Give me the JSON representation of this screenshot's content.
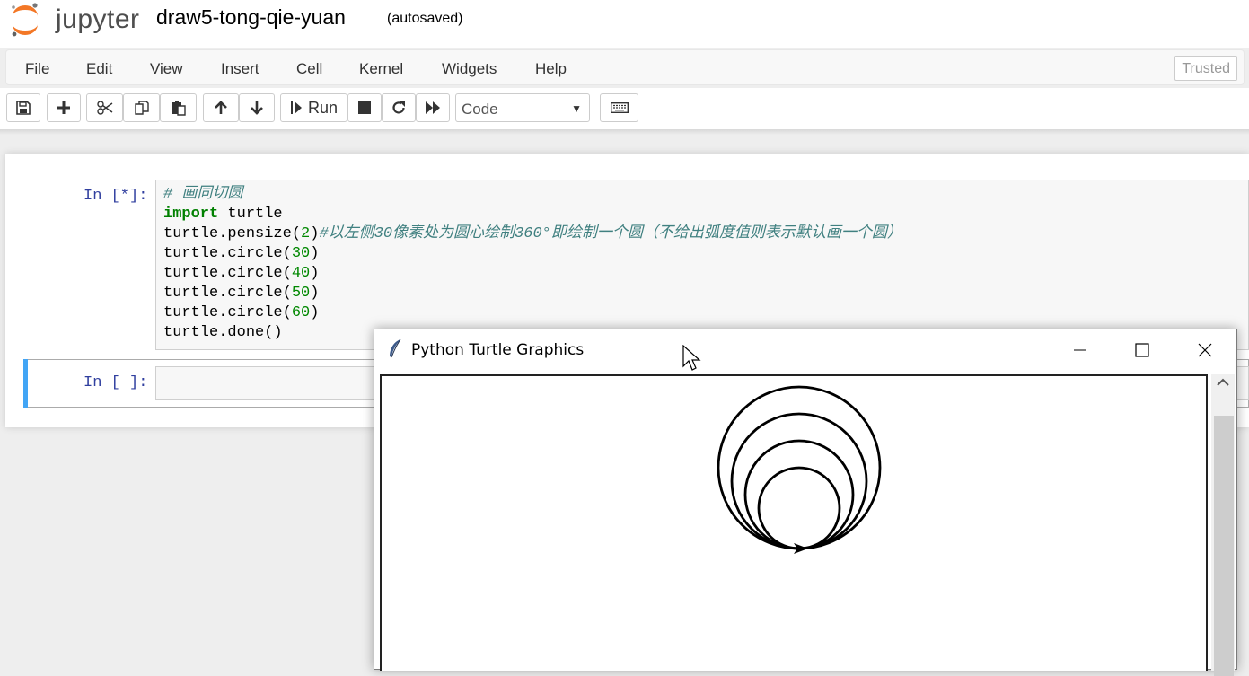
{
  "header": {
    "logo_text": "jupyter",
    "notebook_title": "draw5-tong-qie-yuan",
    "autosave_status": "(autosaved)"
  },
  "menubar": {
    "items": [
      "File",
      "Edit",
      "View",
      "Insert",
      "Cell",
      "Kernel",
      "Widgets",
      "Help"
    ],
    "trusted_label": "Trusted"
  },
  "toolbar": {
    "run_label": "Run",
    "cell_type": "Code",
    "icons": [
      "save-icon",
      "plus-icon",
      "scissors-icon",
      "copy-icon",
      "paste-icon",
      "arrow-up-icon",
      "arrow-down-icon",
      "step-run-icon",
      "stop-icon",
      "restart-icon",
      "fast-forward-icon",
      "keyboard-icon"
    ]
  },
  "cells": [
    {
      "prompt": "In [*]:",
      "code": [
        {
          "parts": [
            {
              "t": "# 画同切圆",
              "c": "cm"
            }
          ]
        },
        {
          "parts": [
            {
              "t": "import",
              "c": "kw"
            },
            {
              "t": " turtle",
              "c": ""
            }
          ]
        },
        {
          "parts": [
            {
              "t": "turtle.pensize(",
              "c": ""
            },
            {
              "t": "2",
              "c": "num"
            },
            {
              "t": ")",
              "c": ""
            },
            {
              "t": "#以左侧30像素处为圆心绘制360°即绘制一个圆（不给出弧度值则表示默认画一个圆）",
              "c": "cm"
            }
          ]
        },
        {
          "parts": [
            {
              "t": "turtle.circle(",
              "c": ""
            },
            {
              "t": "30",
              "c": "num"
            },
            {
              "t": ")",
              "c": ""
            }
          ]
        },
        {
          "parts": [
            {
              "t": "turtle.circle(",
              "c": ""
            },
            {
              "t": "40",
              "c": "num"
            },
            {
              "t": ")",
              "c": ""
            }
          ]
        },
        {
          "parts": [
            {
              "t": "turtle.circle(",
              "c": ""
            },
            {
              "t": "50",
              "c": "num"
            },
            {
              "t": ")",
              "c": ""
            }
          ]
        },
        {
          "parts": [
            {
              "t": "turtle.circle(",
              "c": ""
            },
            {
              "t": "60",
              "c": "num"
            },
            {
              "t": ")",
              "c": ""
            }
          ]
        },
        {
          "parts": [
            {
              "t": "turtle.done()",
              "c": ""
            }
          ]
        }
      ]
    },
    {
      "prompt": "In [ ]:",
      "code": []
    }
  ],
  "turtle_window": {
    "title": "Python Turtle Graphics",
    "icons": [
      "feather-icon",
      "minimize-icon",
      "maximize-icon",
      "close-icon"
    ],
    "drawing": {
      "pensize": 2,
      "circle_radii": [
        30,
        40,
        50,
        60
      ]
    }
  },
  "colors": {
    "prompt_in": "#303f9f",
    "keyword": "#008000",
    "number": "#008800",
    "comment": "#408080",
    "selected_cell_bar": "#42a5f5",
    "logo_orange": "#f37726"
  }
}
